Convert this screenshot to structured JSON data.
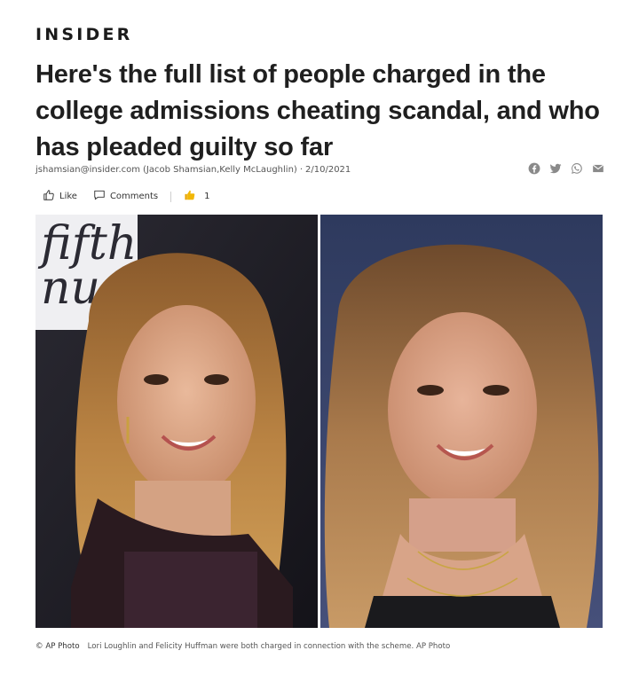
{
  "brand": {
    "name": "INSIDER"
  },
  "article": {
    "title": "Here's the full list of people charged in the college admissions cheating scandal, and who has pleaded guilty so far",
    "byline": {
      "email": "jshamsian@insider.com",
      "authors": "(Jacob Shamsian,Kelly McLaughlin)",
      "separator": "·",
      "date": "2/10/2021"
    }
  },
  "share": {
    "icons": [
      "facebook-icon",
      "twitter-icon",
      "whatsapp-icon",
      "email-icon"
    ]
  },
  "actions": {
    "like_label": "Like",
    "comments_label": "Comments",
    "reaction_count": "1"
  },
  "photo": {
    "sign_text": "fifth\nnu"
  },
  "caption": {
    "credit": "© AP Photo",
    "text": "Lori Loughlin and Felicity Huffman were both charged in connection with the scheme. AP Photo"
  },
  "colors": {
    "text": "#1f1f1f",
    "muted": "#555555",
    "icon": "#8a8a8a",
    "reaction": "#f2b705"
  }
}
